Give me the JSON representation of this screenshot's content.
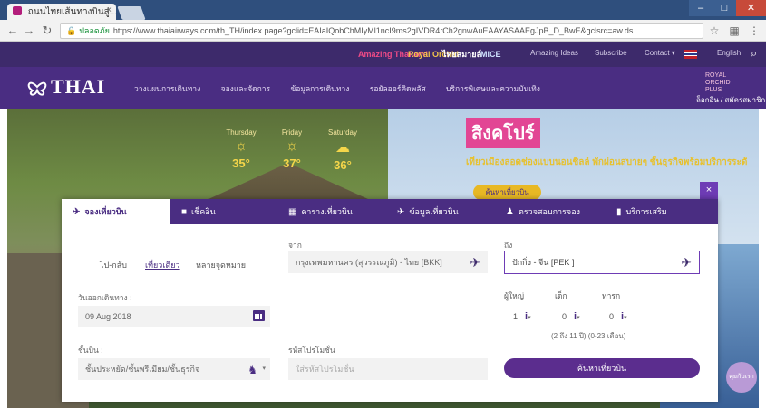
{
  "browser": {
    "tab_title": "ถนนไทยเส้นทางบินสู่...",
    "tab_close": "×",
    "secure_label": "ปลอดภัย",
    "url": "https://www.thaiairways.com/th_TH/index.page?gclid=EAIaIQobChMIyMl1ncI9ms2gIVDR4rCh2gnwAuEAAYASAAEgJpB_D_BwE&gclsrc=aw.ds",
    "icons": [
      "back-icon",
      "forward-icon",
      "reload-icon",
      "lock-icon",
      "star-icon",
      "extension-icon",
      "menu-icon"
    ]
  },
  "topbar": {
    "partners": [
      "Amazing Thailand",
      "Royal Orchid",
      "ไทยสมายล์",
      "MICE"
    ],
    "links": [
      "Amazing Ideas",
      "Subscribe",
      "Contact ▾",
      "English"
    ]
  },
  "nav": {
    "brand": "THAI",
    "links": [
      "วางแผนการเดินทาง",
      "จองและจัดการ",
      "ข้อมูลการเดินทาง",
      "รอยัลออร์คิดพลัส",
      "บริการพิเศษและความบันเทิง"
    ],
    "rop_logo": "ROYAL ORCHID PLUS",
    "login_link": "ล็อกอิน / สมัครสมาชิก"
  },
  "hero": {
    "weather": [
      {
        "day": "Thursday",
        "icon": "sun-icon",
        "temp": "35°"
      },
      {
        "day": "Friday",
        "icon": "sun-icon",
        "temp": "37°"
      },
      {
        "day": "Saturday",
        "icon": "cloud-icon",
        "temp": "36°"
      }
    ],
    "promo_title": "สิงคโปร์",
    "promo_sub": "เที่ยวเมืองลอดช่องแบบนอนชิลล์ พักผ่อนสบายๆ ชั้นธุรกิจพร้อมบริการระดับพรีเมียม",
    "promo_button": "ค้นหาเที่ยวบิน",
    "close": "×"
  },
  "booking": {
    "tabs": [
      {
        "icon": "✈",
        "label": "จองเที่ยวบิน"
      },
      {
        "icon": "■",
        "label": "เช็คอิน"
      },
      {
        "icon": "▦",
        "label": "ตารางเที่ยวบิน"
      },
      {
        "icon": "✈",
        "label": "ข้อมูลเที่ยวบิน"
      },
      {
        "icon": "♟",
        "label": "ตรวจสอบการจอง"
      },
      {
        "icon": "▮",
        "label": "บริการเสริม"
      }
    ],
    "trip_types": [
      "ไป-กลับ",
      "เที่ยวเดียว",
      "หลายจุดหมาย"
    ],
    "selected_trip": "เที่ยวเดียว",
    "from_label": "จาก",
    "from_value": "กรุงเทพมหานคร (สุวรรณภูมิ) - ไทย [BKK]",
    "to_label": "ถึง",
    "to_value": "ปักกิ่ง - จีน [PEK ]",
    "date_label": "วันออกเดินทาง :",
    "date_value": "09 Aug 2018",
    "class_label": "ชั้นบิน :",
    "class_value": "ชั้นประหยัด/ชั้นพรีเมียม/ชั้นธุรกิจ",
    "promo_label": "รหัสโปรโมชั่น",
    "promo_placeholder": "ใส่รหัสโปรโมชั่น",
    "pax_labels": [
      "ผู้ใหญ่",
      "เด็ก",
      "ทารก"
    ],
    "pax_values": [
      "1",
      "0",
      "0"
    ],
    "pax_ages": "(2 ถึง 11 ปี)   (0-23 เดือน)",
    "search_button": "ค้นหาเที่ยวบิน"
  },
  "chat": "คุยกับเรา"
}
